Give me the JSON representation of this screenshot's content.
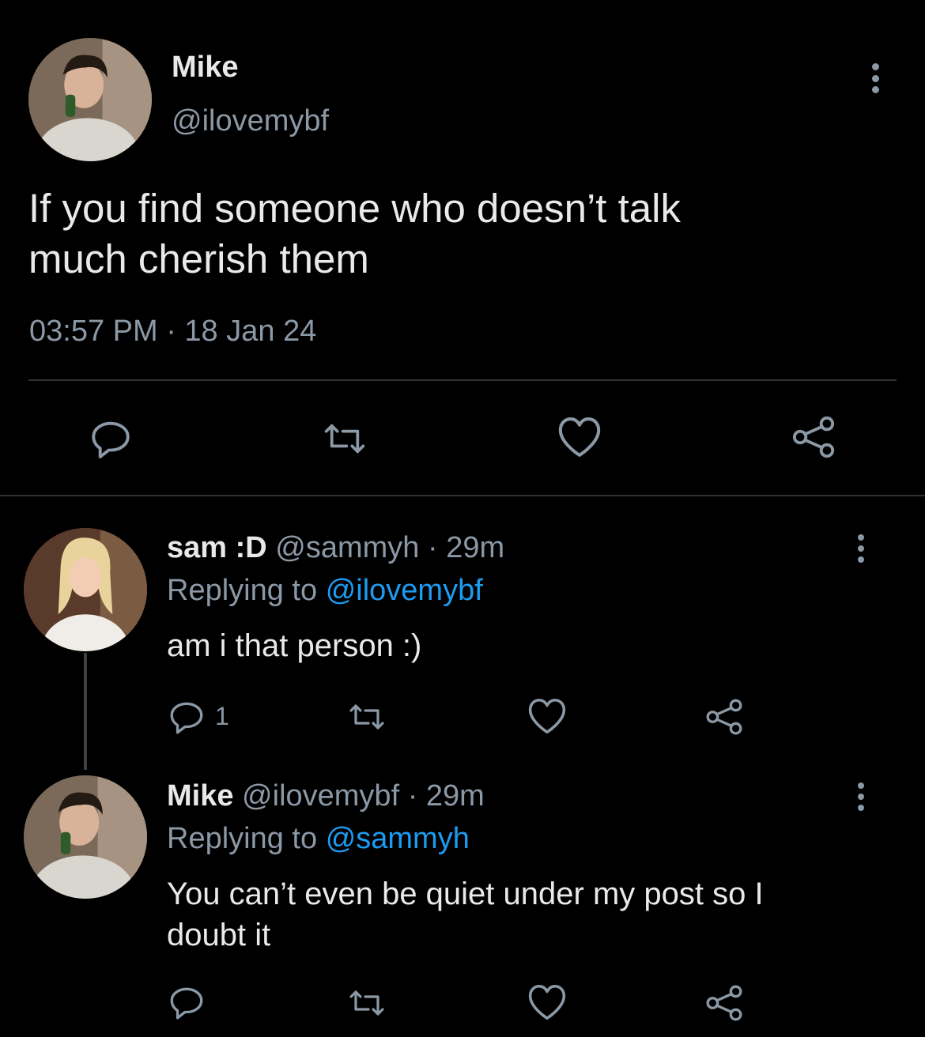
{
  "main_tweet": {
    "author_name": "Mike",
    "author_handle": "@ilovemybf",
    "text_line1": "If you find someone who doesn’t talk",
    "text_line2": "much cherish them",
    "timestamp": "03:57 PM · 18 Jan 24"
  },
  "replies": [
    {
      "author_name": "sam :D",
      "author_handle": "@sammyh",
      "age": "· 29m",
      "replying_prefix": "Replying to",
      "replying_handle": "@ilovemybf",
      "text_line1": "am i that person :)",
      "reply_count": "1"
    },
    {
      "author_name": "Mike",
      "author_handle": "@ilovemybf",
      "age": "· 29m",
      "replying_prefix": "Replying to",
      "replying_handle": "@sammyh",
      "text_line1": "You can’t even be quiet under my post so I",
      "text_line2": "doubt it"
    }
  ],
  "colors": {
    "background": "#000000",
    "text": "#e7e9ea",
    "muted": "#8b98a5",
    "link": "#1d9bf0",
    "divider": "#2f3336"
  },
  "icons": [
    "reply-icon",
    "retweet-icon",
    "like-icon",
    "share-icon",
    "more-icon"
  ]
}
